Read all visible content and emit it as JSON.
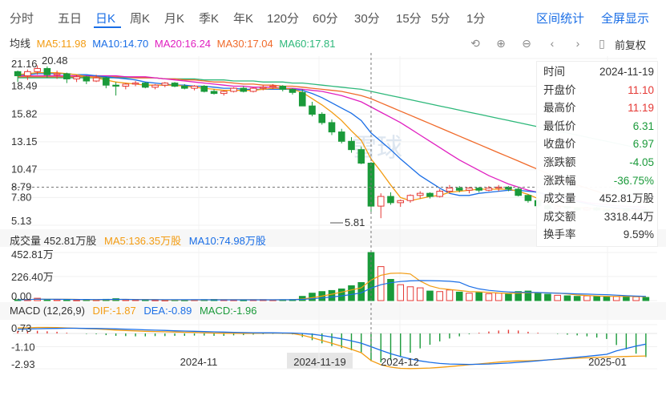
{
  "tabs": [
    "分时",
    "五日",
    "日K",
    "周K",
    "月K",
    "季K",
    "年K",
    "120分",
    "60分",
    "30分",
    "15分",
    "5分",
    "1分"
  ],
  "active_tab": "日K",
  "tab_actions": [
    "区间统计",
    "全屏显示"
  ],
  "fq_label": "前复权",
  "ma_legend": {
    "title": "均线",
    "items": [
      {
        "label": "MA5:11.98",
        "color": "#f39c12"
      },
      {
        "label": "MA10:14.70",
        "color": "#1a6ee6"
      },
      {
        "label": "MA20:16.24",
        "color": "#e020c0"
      },
      {
        "label": "MA30:17.04",
        "color": "#f06a2a"
      },
      {
        "label": "MA60:17.81",
        "color": "#2db87a"
      }
    ]
  },
  "price_axis_labels": [
    "21.16",
    "18.49",
    "15.82",
    "13.15",
    "10.47",
    "8.79",
    "7.80",
    "5.13"
  ],
  "annotations": {
    "high": "20.48",
    "low": "5.81"
  },
  "watermark": "雪球",
  "tooltip": {
    "rows": [
      {
        "label": "时间",
        "value": "2024-11-19",
        "color": "#333333"
      },
      {
        "label": "开盘价",
        "value": "11.10",
        "color": "#e53935"
      },
      {
        "label": "最高价",
        "value": "11.19",
        "color": "#e53935"
      },
      {
        "label": "最低价",
        "value": "6.31",
        "color": "#1a9a3a"
      },
      {
        "label": "收盘价",
        "value": "6.97",
        "color": "#1a9a3a"
      },
      {
        "label": "涨跌额",
        "value": "-4.05",
        "color": "#1a9a3a"
      },
      {
        "label": "涨跌幅",
        "value": "-36.75%",
        "color": "#1a9a3a"
      },
      {
        "label": "成交量",
        "value": "452.81万股",
        "color": "#333333"
      },
      {
        "label": "成交额",
        "value": "3318.44万",
        "color": "#333333"
      },
      {
        "label": "换手率",
        "value": "9.59%",
        "color": "#333333"
      }
    ]
  },
  "volume_legend": {
    "items": [
      {
        "label": "成交量 452.81万股",
        "color": "#333333"
      },
      {
        "label": "MA5:136.35万股",
        "color": "#f39c12"
      },
      {
        "label": "MA10:74.98万股",
        "color": "#1a6ee6"
      }
    ],
    "axis_labels": [
      "452.81万",
      "226.40万",
      "0.00"
    ]
  },
  "macd_legend": {
    "items": [
      {
        "label": "MACD (12,26,9)",
        "color": "#333333"
      },
      {
        "label": "DIF:-1.87",
        "color": "#f39c12"
      },
      {
        "label": "DEA:-0.89",
        "color": "#1a6ee6"
      },
      {
        "label": "MACD:-1.96",
        "color": "#1a9a3a"
      }
    ],
    "axis_labels": [
      "0.73",
      "-1.10",
      "-2.93"
    ]
  },
  "date_labels": [
    "2024-11",
    "2024-11-19",
    "2024-12",
    "2025-01"
  ],
  "colors": {
    "up": "#e53935",
    "down": "#1a9a3a",
    "accent": "#1a6ee6"
  },
  "chart_data": {
    "type": "candlestick",
    "price_range": [
      5.13,
      21.16
    ],
    "volume_range": [
      0,
      452.81
    ],
    "macd_range": [
      -2.93,
      0.73
    ],
    "crosshair": {
      "date": "2024-11-19",
      "price": 8.79
    },
    "candles": [
      [
        19.9,
        20.0,
        18.9,
        19.5
      ],
      [
        19.5,
        20.1,
        19.1,
        19.9
      ],
      [
        19.9,
        20.5,
        19.6,
        20.2
      ],
      [
        20.2,
        20.4,
        19.3,
        19.6
      ],
      [
        19.6,
        20.0,
        19.2,
        19.7
      ],
      [
        19.7,
        19.8,
        18.8,
        19.2
      ],
      [
        19.2,
        19.6,
        18.9,
        19.4
      ],
      [
        19.4,
        19.5,
        18.7,
        19.0
      ],
      [
        19.0,
        19.6,
        18.9,
        19.3
      ],
      [
        19.3,
        19.4,
        18.3,
        18.6
      ],
      [
        18.6,
        18.9,
        17.6,
        18.5
      ],
      [
        18.5,
        18.8,
        18.2,
        18.7
      ],
      [
        18.7,
        19.0,
        18.5,
        18.8
      ],
      [
        18.8,
        18.9,
        18.3,
        18.4
      ],
      [
        18.4,
        18.7,
        18.2,
        18.6
      ],
      [
        18.6,
        18.9,
        18.4,
        18.8
      ],
      [
        18.8,
        18.9,
        18.4,
        18.5
      ],
      [
        18.5,
        18.7,
        18.2,
        18.3
      ],
      [
        18.3,
        18.6,
        18.1,
        18.5
      ],
      [
        18.5,
        18.6,
        17.9,
        18.0
      ],
      [
        18.0,
        18.2,
        17.7,
        17.8
      ],
      [
        17.8,
        18.1,
        17.6,
        18.0
      ],
      [
        18.0,
        18.4,
        17.9,
        18.3
      ],
      [
        18.3,
        18.5,
        17.9,
        18.0
      ],
      [
        18.0,
        18.4,
        17.9,
        18.3
      ],
      [
        18.3,
        18.6,
        18.1,
        18.4
      ],
      [
        18.4,
        18.7,
        18.2,
        18.5
      ],
      [
        18.5,
        18.6,
        18.0,
        18.2
      ],
      [
        18.2,
        18.3,
        17.7,
        17.9
      ],
      [
        17.9,
        18.2,
        16.6,
        16.6
      ],
      [
        16.6,
        17.0,
        15.6,
        15.8
      ],
      [
        15.8,
        16.0,
        14.8,
        15.0
      ],
      [
        15.0,
        15.3,
        13.8,
        14.1
      ],
      [
        14.1,
        14.4,
        13.0,
        13.2
      ],
      [
        13.2,
        13.6,
        12.1,
        12.4
      ],
      [
        12.4,
        12.7,
        11.0,
        11.1
      ],
      [
        11.1,
        11.2,
        6.31,
        6.97
      ],
      [
        6.97,
        8.2,
        5.81,
        7.9
      ],
      [
        7.9,
        8.3,
        7.1,
        7.3
      ],
      [
        7.3,
        7.6,
        6.9,
        7.5
      ],
      [
        7.5,
        8.1,
        7.3,
        8.0
      ],
      [
        8.0,
        8.4,
        7.7,
        8.2
      ],
      [
        8.2,
        8.3,
        7.7,
        7.9
      ],
      [
        7.9,
        8.6,
        7.8,
        8.4
      ],
      [
        8.4,
        9.0,
        8.2,
        8.7
      ],
      [
        8.7,
        8.9,
        8.3,
        8.5
      ],
      [
        8.5,
        8.8,
        8.2,
        8.7
      ],
      [
        8.7,
        8.8,
        8.3,
        8.5
      ],
      [
        8.5,
        8.9,
        8.4,
        8.7
      ],
      [
        8.7,
        9.0,
        8.4,
        8.8
      ],
      [
        8.8,
        8.9,
        8.4,
        8.6
      ],
      [
        8.6,
        8.8,
        7.9,
        8.0
      ],
      [
        8.0,
        8.1,
        7.3,
        7.5
      ],
      [
        7.5,
        7.6,
        6.8,
        7.0
      ],
      [
        7.0,
        7.2,
        6.5,
        6.7
      ],
      [
        6.7,
        7.1,
        6.6,
        6.9
      ],
      [
        6.9,
        7.0,
        6.6,
        6.8
      ],
      [
        6.8,
        6.9,
        6.5,
        6.6
      ],
      [
        6.6,
        6.9,
        6.5,
        6.8
      ],
      [
        6.8,
        6.9,
        6.5,
        6.6
      ],
      [
        6.6,
        6.7,
        6.3,
        6.5
      ],
      [
        6.5,
        6.8,
        6.4,
        6.7
      ],
      [
        6.7,
        6.8,
        6.4,
        6.5
      ],
      [
        6.5,
        6.7,
        6.3,
        6.6
      ],
      [
        6.6,
        6.7,
        6.3,
        6.4
      ]
    ],
    "volumes": [
      8,
      10,
      22,
      12,
      9,
      7,
      6,
      9,
      7,
      12,
      18,
      9,
      8,
      7,
      6,
      5,
      7,
      6,
      8,
      9,
      11,
      8,
      7,
      6,
      8,
      9,
      7,
      8,
      10,
      40,
      70,
      85,
      95,
      110,
      140,
      170,
      452.81,
      320,
      200,
      150,
      130,
      120,
      90,
      85,
      100,
      80,
      70,
      75,
      65,
      70,
      60,
      85,
      90,
      70,
      60,
      50,
      45,
      40,
      45,
      38,
      35,
      40,
      42,
      36,
      30
    ],
    "dif": [
      0.45,
      0.47,
      0.5,
      0.5,
      0.49,
      0.46,
      0.43,
      0.4,
      0.38,
      0.33,
      0.28,
      0.24,
      0.21,
      0.18,
      0.16,
      0.14,
      0.12,
      0.1,
      0.09,
      0.06,
      0.03,
      0.01,
      0.01,
      0.0,
      0.01,
      0.02,
      0.03,
      0.02,
      -0.01,
      -0.15,
      -0.35,
      -0.58,
      -0.82,
      -1.06,
      -1.32,
      -1.6,
      -2.25,
      -2.6,
      -2.8,
      -2.9,
      -2.92,
      -2.9,
      -2.87,
      -2.82,
      -2.75,
      -2.68,
      -2.6,
      -2.53,
      -2.46,
      -2.38,
      -2.31,
      -2.28,
      -2.27,
      -2.24,
      -2.2,
      -2.15,
      -2.1,
      -2.06,
      -2.02,
      -1.99,
      -1.96,
      -1.93,
      -1.91,
      -1.89,
      -1.87
    ],
    "dea": [
      0.35,
      0.37,
      0.39,
      0.41,
      0.42,
      0.43,
      0.43,
      0.42,
      0.41,
      0.4,
      0.38,
      0.35,
      0.33,
      0.3,
      0.27,
      0.25,
      0.22,
      0.2,
      0.18,
      0.15,
      0.13,
      0.11,
      0.09,
      0.07,
      0.06,
      0.05,
      0.05,
      0.04,
      0.03,
      0.0,
      -0.07,
      -0.17,
      -0.3,
      -0.45,
      -0.62,
      -0.81,
      -1.1,
      -1.4,
      -1.68,
      -1.92,
      -2.12,
      -2.28,
      -2.4,
      -2.49,
      -2.54,
      -2.56,
      -2.57,
      -2.56,
      -2.54,
      -2.5,
      -2.46,
      -2.4,
      -2.34,
      -2.27,
      -2.2,
      -2.13,
      -2.05,
      -1.98,
      -1.9,
      -1.82,
      -1.73,
      -1.45,
      -1.25,
      -1.05,
      -0.89
    ],
    "ma5": [
      19.6,
      19.7,
      19.8,
      19.8,
      19.8,
      19.7,
      19.6,
      19.4,
      19.3,
      19.1,
      18.9,
      18.8,
      18.7,
      18.6,
      18.6,
      18.6,
      18.6,
      18.5,
      18.4,
      18.3,
      18.2,
      18.1,
      18.1,
      18.1,
      18.1,
      18.2,
      18.3,
      18.3,
      18.2,
      17.9,
      17.3,
      16.7,
      16.0,
      15.2,
      14.2,
      13.3,
      11.5,
      10.3,
      9.0,
      7.8,
      7.5,
      7.7,
      7.9,
      8.0,
      8.3,
      8.4,
      8.5,
      8.6,
      8.6,
      8.6,
      8.6,
      8.4,
      8.1,
      7.7,
      7.3,
      7.0,
      6.9,
      6.8,
      6.8,
      6.7,
      6.7,
      6.65,
      6.6,
      6.6,
      6.55
    ],
    "ma10": [
      19.6,
      19.6,
      19.7,
      19.7,
      19.7,
      19.7,
      19.6,
      19.6,
      19.5,
      19.4,
      19.3,
      19.2,
      19.1,
      18.9,
      18.8,
      18.7,
      18.6,
      18.6,
      18.5,
      18.5,
      18.4,
      18.3,
      18.3,
      18.2,
      18.2,
      18.2,
      18.2,
      18.2,
      18.2,
      18.1,
      17.8,
      17.4,
      16.9,
      16.4,
      15.9,
      15.2,
      14.0,
      13.2,
      12.4,
      11.5,
      10.7,
      9.9,
      9.3,
      8.7,
      8.2,
      8.0,
      8.0,
      8.2,
      8.3,
      8.4,
      8.5,
      8.5,
      8.4,
      8.3,
      8.1,
      7.9,
      7.7,
      7.4,
      7.2,
      7.0,
      6.9,
      6.8,
      6.75,
      6.7,
      6.65
    ],
    "ma20": [
      19.5,
      19.5,
      19.5,
      19.5,
      19.5,
      19.5,
      19.5,
      19.5,
      19.5,
      19.5,
      19.5,
      19.4,
      19.4,
      19.4,
      19.3,
      19.2,
      19.1,
      19.0,
      18.9,
      18.8,
      18.7,
      18.6,
      18.5,
      18.5,
      18.4,
      18.4,
      18.4,
      18.3,
      18.3,
      18.2,
      18.1,
      18.0,
      17.8,
      17.6,
      17.3,
      17.0,
      16.5,
      16.0,
      15.5,
      15.0,
      14.4,
      13.8,
      13.2,
      12.6,
      12.0,
      11.4,
      10.9,
      10.4,
      9.9,
      9.5,
      9.1,
      8.8,
      8.5,
      8.3,
      8.0,
      7.8,
      7.6,
      7.5,
      7.3,
      7.2,
      7.1,
      7.0,
      6.95,
      6.9,
      6.85
    ],
    "ma30": [
      19.4,
      19.4,
      19.4,
      19.4,
      19.4,
      19.4,
      19.4,
      19.4,
      19.4,
      19.4,
      19.4,
      19.4,
      19.3,
      19.3,
      19.3,
      19.2,
      19.2,
      19.1,
      19.1,
      19.0,
      18.9,
      18.9,
      18.8,
      18.7,
      18.7,
      18.6,
      18.6,
      18.5,
      18.5,
      18.4,
      18.3,
      18.2,
      18.1,
      18.0,
      17.8,
      17.6,
      17.3,
      16.9,
      16.5,
      16.1,
      15.7,
      15.3,
      14.9,
      14.5,
      14.1,
      13.7,
      13.3,
      12.9,
      12.5,
      12.1,
      11.7,
      11.3,
      10.9,
      10.5,
      10.1,
      9.7,
      9.3,
      9.0,
      8.7,
      8.4,
      8.1,
      7.9,
      7.7,
      7.5,
      7.3
    ],
    "ma60": [
      19.3,
      19.3,
      19.3,
      19.3,
      19.3,
      19.3,
      19.3,
      19.3,
      19.3,
      19.3,
      19.3,
      19.3,
      19.3,
      19.3,
      19.3,
      19.2,
      19.2,
      19.2,
      19.2,
      19.1,
      19.1,
      19.1,
      19.0,
      19.0,
      19.0,
      18.9,
      18.9,
      18.9,
      18.8,
      18.8,
      18.7,
      18.6,
      18.5,
      18.4,
      18.3,
      18.2,
      18.0,
      17.8,
      17.6,
      17.4,
      17.2,
      17.0,
      16.8,
      16.6,
      16.4,
      16.2,
      16.0,
      15.8,
      15.6,
      15.4,
      15.2,
      15.0,
      14.8,
      14.6,
      14.4,
      14.2,
      14.0,
      13.8,
      13.6,
      13.4,
      13.2,
      13.0,
      12.8,
      12.6,
      12.4
    ]
  }
}
